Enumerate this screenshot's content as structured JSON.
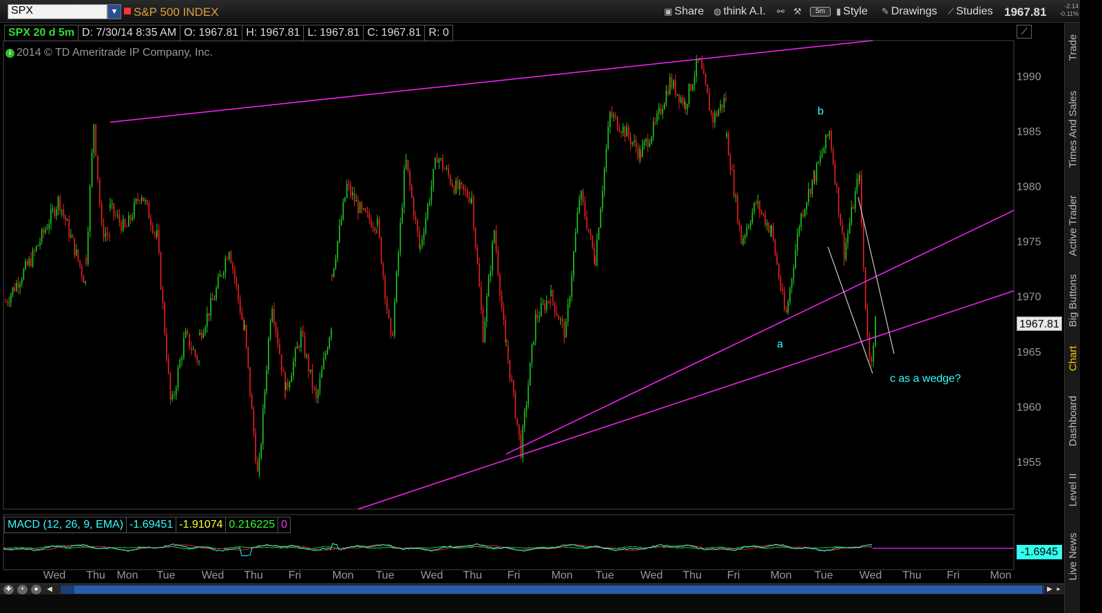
{
  "toolbar": {
    "symbol": "SPX",
    "instrument_name": "S&P 500 INDEX",
    "share": "Share",
    "think_ai": "think A.I.",
    "interval": "5m",
    "style": "Style",
    "drawings": "Drawings",
    "studies": "Studies",
    "last_price": "1967.81",
    "net_change": "-2.14",
    "percent_change": "-0.11%"
  },
  "info_bar": {
    "chart_id": "SPX 20 d 5m",
    "date": "D: 7/30/14 8:35 AM",
    "open": "O: 1967.81",
    "high": "H: 1967.81",
    "low": "L: 1967.81",
    "close": "C: 1967.81",
    "range": "R: 0"
  },
  "copyright": "2014 © TD Ameritrade IP Company, Inc.",
  "copyright_icon_letter": "i",
  "price_tag": "1967.81",
  "macd": {
    "label": "MACD (12, 26, 9, EMA)",
    "value": "-1.69451",
    "avg": "-1.91074",
    "diff": "0.216225",
    "zero": "0",
    "tag": "-1.6945",
    "colors": {
      "label": "#33ffff",
      "value": "#33ffff",
      "avg": "#ffff33",
      "diff": "#33ff33",
      "zero": "#ff33ff"
    }
  },
  "side_tabs": [
    "Trade",
    "Times And Sales",
    "Active Trader",
    "Big Buttons",
    "Chart",
    "Dashboard",
    "Level II",
    "Live News"
  ],
  "active_tab": "Chart",
  "colors": {
    "up": "#22cc22",
    "down": "#ee2222",
    "trendline": "#ff22ff",
    "wedge": "#cccccc",
    "annotation": "#33ffff",
    "axis_text": "#999999"
  },
  "icons": {
    "share": "share-icon",
    "think_ai": "think-ai-icon",
    "style": "candle-style-icon",
    "drawings": "pencil-icon",
    "studies": "studies-icon"
  },
  "chart_data": {
    "type": "candlestick",
    "title": "SPX 20 d 5m",
    "y_ticks": [
      1955,
      1960,
      1965,
      1970,
      1975,
      1980,
      1985,
      1990
    ],
    "ylim": [
      1950.7,
      1993.2
    ],
    "x_ticks": [
      "Wed",
      "Thu",
      "Mon",
      "Tue",
      "Wed",
      "Thu",
      "Fri",
      "Mon",
      "Tue",
      "Wed",
      "Thu",
      "Fri",
      "Mon",
      "Tue",
      "Wed",
      "Thu",
      "Fri",
      "Mon",
      "Tue",
      "Wed",
      "Thu",
      "Fri",
      "Mon"
    ],
    "sessions": [
      "Wed",
      "Thu",
      "Mon",
      "Tue",
      "Wed",
      "Thu",
      "Fri",
      "Mon",
      "Tue",
      "Wed",
      "Thu",
      "Fri",
      "Mon",
      "Tue",
      "Wed",
      "Thu",
      "Fri",
      "Mon",
      "Tue",
      "Wed"
    ],
    "session_ranges": [
      [
        1969.5,
        1973.5,
        1978.8,
        1971.2
      ],
      [
        1973.5,
        1985.8,
        1976.0,
        1975.5
      ],
      [
        1978.0,
        1976.0,
        1979.5,
        1975.5
      ],
      [
        1975.5,
        1959.8,
        1966.5,
        1964.0
      ],
      [
        1966.5,
        1970.0,
        1974.5,
        1967.0
      ],
      [
        1967.0,
        1953.2,
        1969.8,
        1961.5
      ],
      [
        1961.5,
        1966.5,
        1960.5,
        1967.5
      ],
      [
        1972.0,
        1980.0,
        1977.5,
        1976.5
      ],
      [
        1976.5,
        1965.5,
        1982.5,
        1974.5
      ],
      [
        1974.5,
        1982.8,
        1980.0,
        1979.0
      ],
      [
        1979.0,
        1966.5,
        1976.0,
        1965.5
      ],
      [
        1965.5,
        1956.0,
        1968.0,
        1970.0
      ],
      [
        1970.0,
        1966.5,
        1979.5,
        1973.5
      ],
      [
        1973.5,
        1986.5,
        1985.0,
        1983.0
      ],
      [
        1983.0,
        1985.5,
        1989.5,
        1987.5
      ],
      [
        1987.5,
        1991.5,
        1986.0,
        1988.0
      ],
      [
        1984.5,
        1975.0,
        1978.5,
        1976.0
      ],
      [
        1976.0,
        1968.0,
        1977.0,
        1981.0
      ],
      [
        1981.0,
        1985.0,
        1974.0,
        1981.0
      ],
      [
        1980.5,
        1970.0,
        1963.5,
        1967.8
      ]
    ],
    "trendlines": [
      {
        "from": [
          "Thu",
          1985.8
        ],
        "to": [
          "Wed",
          1993.2
        ]
      },
      {
        "from": [
          "Fri",
          1955.7
        ],
        "to": [
          "Mon",
          1977.8
        ]
      },
      {
        "from": [
          "Thu",
          1950.7
        ],
        "to": [
          "Mon",
          1970.5
        ]
      }
    ],
    "annotations": [
      {
        "text": "a",
        "price": 1966.5
      },
      {
        "text": "b",
        "price": 1986.0
      },
      {
        "text": "c as a wedge?",
        "price": 1962.5
      }
    ],
    "current_price": 1967.81
  }
}
